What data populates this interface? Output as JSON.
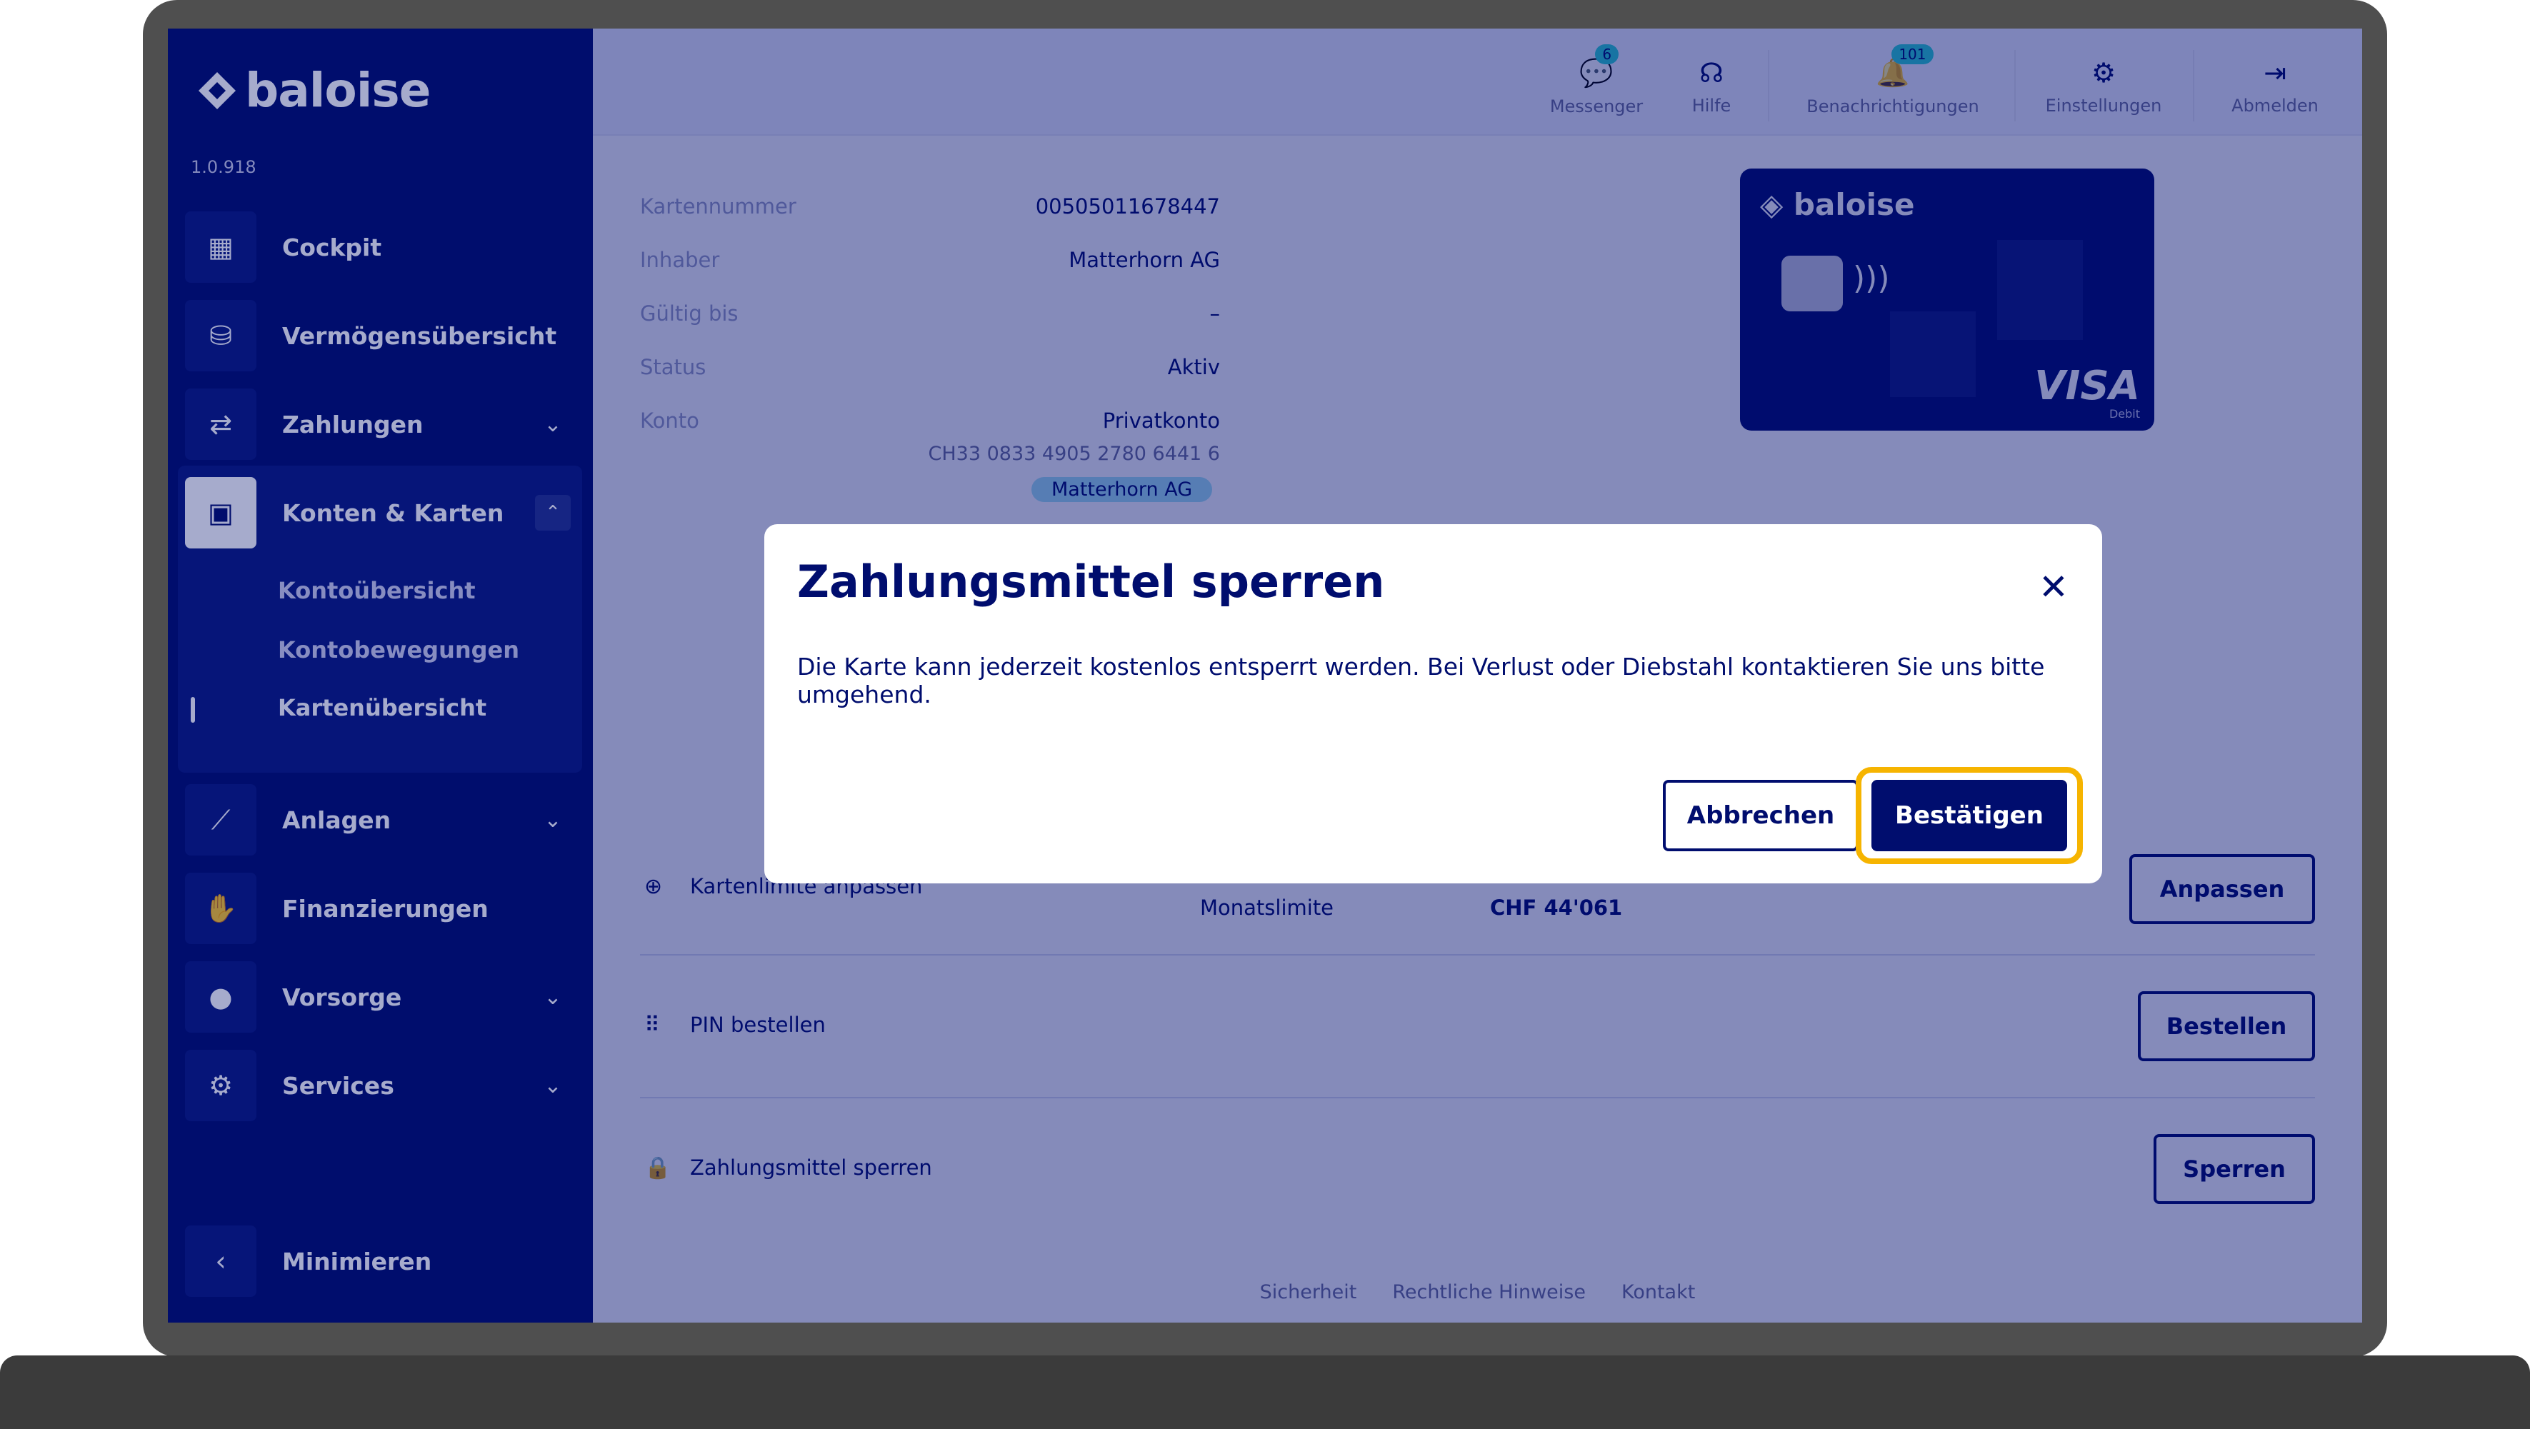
{
  "app": {
    "brand": "baloise",
    "version": "1.0.918"
  },
  "sidebar": {
    "items": [
      {
        "label": "Cockpit",
        "icon": "dashboard-icon"
      },
      {
        "label": "Vermögensübersicht",
        "icon": "coins-icon"
      },
      {
        "label": "Zahlungen",
        "icon": "transfer-icon"
      },
      {
        "label": "Konten & Karten",
        "icon": "wallet-icon"
      },
      {
        "label": "Anlagen",
        "icon": "chart-icon"
      },
      {
        "label": "Finanzierungen",
        "icon": "hand-coin-icon"
      },
      {
        "label": "Vorsorge",
        "icon": "piggy-bank-icon"
      },
      {
        "label": "Services",
        "icon": "gear-icon"
      }
    ],
    "sub_items": [
      "Kontoübersicht",
      "Kontobewegungen",
      "Kartenübersicht"
    ],
    "minimize_label": "Minimieren"
  },
  "topbar": {
    "actions": [
      {
        "label": "Messenger",
        "badge": "6",
        "icon": "chat-icon"
      },
      {
        "label": "Hilfe",
        "icon": "headset-icon"
      },
      {
        "label": "Benachrichtigungen",
        "badge": "101",
        "icon": "bell-icon"
      },
      {
        "label": "Einstellungen",
        "icon": "gear-icon"
      },
      {
        "label": "Abmelden",
        "icon": "logout-icon"
      }
    ]
  },
  "card_info": {
    "rows": [
      {
        "key": "Kartennummer",
        "value": "00505011678447"
      },
      {
        "key": "Inhaber",
        "value": "Matterhorn AG"
      },
      {
        "key": "Gültig bis",
        "value": "–"
      },
      {
        "key": "Status",
        "value": "Aktiv"
      },
      {
        "key": "Konto",
        "value": "Privatkonto"
      }
    ],
    "iban": "CH33 0833 4905 2780 6441 6",
    "tag": "Matterhorn AG"
  },
  "card_visual": {
    "brand": "baloise",
    "network": "VISA",
    "network_sub": "Debit"
  },
  "actions": {
    "limit": {
      "label": "Kartenlimite anpassen",
      "col1": "Monatslimite",
      "col2": "CHF 44'061",
      "button": "Anpassen"
    },
    "pin": {
      "label": "PIN bestellen",
      "button": "Bestellen"
    },
    "block": {
      "label": "Zahlungsmittel sperren",
      "button": "Sperren"
    }
  },
  "footer": {
    "links": [
      "Sicherheit",
      "Rechtliche Hinweise",
      "Kontakt"
    ]
  },
  "modal": {
    "title": "Zahlungsmittel sperren",
    "text": "Die Karte kann jederzeit kostenlos entsperrt werden. Bei Verlust oder Diebstahl kontaktieren Sie uns bitte umgehend.",
    "cancel_label": "Abbrechen",
    "confirm_label": "Bestätigen"
  },
  "colors": {
    "primary": "#000d6e",
    "highlight": "#f6b400",
    "badge": "#2fd3d3"
  }
}
